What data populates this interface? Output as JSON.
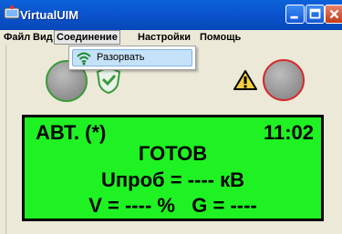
{
  "window": {
    "title": "VirtualUIM",
    "title_bar_color": "#0a55cf",
    "controls": [
      "minimize-icon",
      "maximize-icon",
      "close-icon"
    ]
  },
  "menu": {
    "items": [
      {
        "label": "Файл"
      },
      {
        "label": "Вид"
      },
      {
        "label": "Соединение"
      },
      {
        "label": "Настройки"
      },
      {
        "label": "Помощь"
      }
    ],
    "active_index": 2
  },
  "dropdown": {
    "items": [
      {
        "label": "Разорвать",
        "icon": "wifi-icon"
      }
    ]
  },
  "indicators": {
    "left_lamp_color": "#3a9a3a",
    "right_lamp_color": "#d42b2b",
    "shield_icon": "shield-check-icon",
    "warning_icon": "warning-icon"
  },
  "display": {
    "background": "#1ff223",
    "mode": "АВТ. (*)",
    "time": "11:02",
    "status": "ГОТОВ",
    "voltage": "Uпроб = ---- кВ",
    "vg": "V = ---- %   G = ----"
  }
}
